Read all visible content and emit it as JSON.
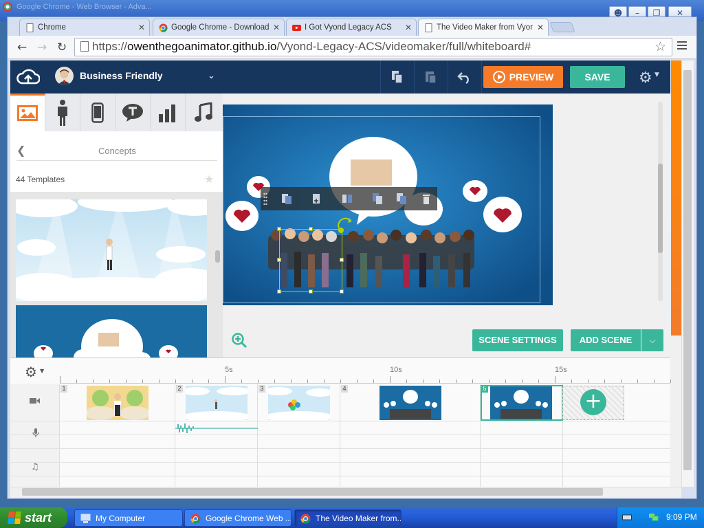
{
  "os": {
    "window_title_partial": "Google Chrome - Web Browser - Adva...",
    "window_controls": [
      "user",
      "minimize",
      "restore",
      "close"
    ]
  },
  "browser": {
    "tabs": [
      {
        "label": "Chrome",
        "icon": "page-icon",
        "active": false
      },
      {
        "label": "Google Chrome - Download t",
        "icon": "chrome-logo-icon",
        "active": false
      },
      {
        "label": "I Got Vyond Legacy ACS",
        "icon": "youtube-icon",
        "active": false
      },
      {
        "label": "The Video Maker from Vyond",
        "icon": "page-icon",
        "active": true
      }
    ],
    "url_prefix": "https://",
    "url_host": "owenthegoanimator.github.io",
    "url_path": "/Vyond-Legacy-ACS/videomaker/full/whiteboard#"
  },
  "app": {
    "theme_name": "Business Friendly",
    "preview_label": "PREVIEW",
    "save_label": "SAVE",
    "categories": [
      "templates",
      "characters",
      "props",
      "text",
      "charts",
      "sounds"
    ],
    "panel": {
      "title": "Concepts",
      "template_count": "44 Templates"
    },
    "scene_settings_label": "SCENE SETTINGS",
    "add_scene_label": "ADD SCENE",
    "timeline": {
      "ruler_labels": [
        "5s",
        "10s",
        "15s"
      ],
      "scenes": [
        "1",
        "2",
        "3",
        "4",
        "5"
      ],
      "tracks": [
        "video",
        "voice",
        "music"
      ],
      "selected_scene": 5
    },
    "colors": {
      "topbar": "#17365e",
      "preview": "#f47b2a",
      "accent": "#3ab79b"
    }
  },
  "taskbar": {
    "start_label": "start",
    "tasks": [
      {
        "label": "My Computer",
        "active": false
      },
      {
        "label": "Google Chrome Web ...",
        "active": false
      },
      {
        "label": "The Video Maker from...",
        "active": true
      }
    ],
    "clock": "9:09 PM"
  }
}
